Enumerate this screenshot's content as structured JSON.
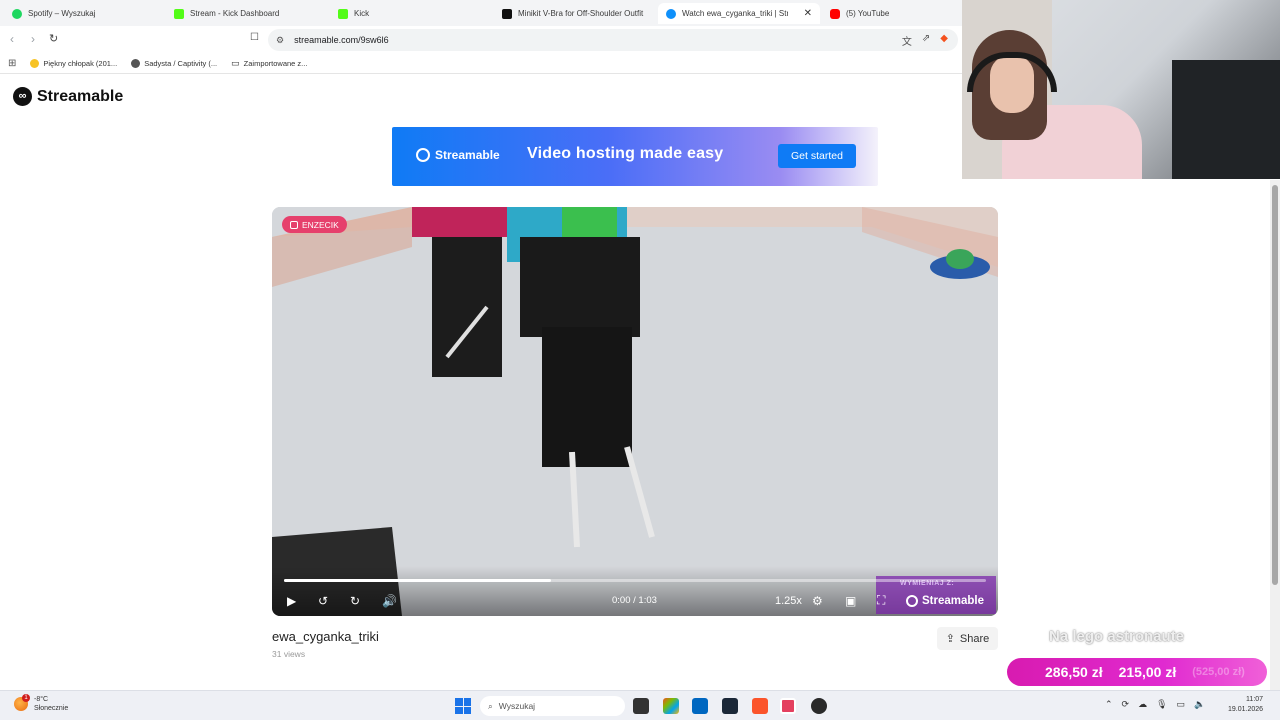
{
  "browser": {
    "tabs": [
      {
        "label": "Spotify – Wyszukaj",
        "favicon": "spotify-icon",
        "active": false
      },
      {
        "label": "Stream - Kick Dashboard",
        "favicon": "kick-icon",
        "active": false
      },
      {
        "label": "Kick",
        "favicon": "kick-icon",
        "active": false
      },
      {
        "label": "Minikit V-Bra for Off-Shoulder Outfit",
        "favicon": "tiktok-icon",
        "active": false
      },
      {
        "label": "Watch ewa_cyganka_triki | Stream",
        "favicon": "streamable-icon",
        "active": true
      },
      {
        "label": "(5) YouTube",
        "favicon": "youtube-icon",
        "active": false
      }
    ],
    "url": "streamable.com/9sw6l6",
    "bookmarks": [
      {
        "label": "Piękny chłopak (201...",
        "icon": "emoji-icon"
      },
      {
        "label": "Sadysta / Captivity (...",
        "icon": "globe-icon"
      },
      {
        "label": "Zaimportowane z...",
        "icon": "folder-icon"
      }
    ]
  },
  "page": {
    "logo_text": "Streamable",
    "banner": {
      "brand": "Streamable",
      "headline": "Video hosting made easy",
      "cta": "Get started"
    },
    "video": {
      "tag": "ENZECIK",
      "time": "0:00 / 1:03",
      "speed": "1.25x",
      "brand": "Streamable",
      "overlay_label": "WYMIENIAJ Z:",
      "progress": 0.38
    },
    "title": "ewa_cyganka_triki",
    "views": "31 views",
    "share_label": "Share"
  },
  "stream_overlay": {
    "caption": "Na lego astronaute",
    "donation_current": "286,50 zł",
    "donation_second": "215,00 zł",
    "donation_goal": "(525,00 zł)"
  },
  "taskbar": {
    "weather_temp": "-8°C",
    "weather_desc": "Słonecznie",
    "weather_badge": "1",
    "search_placeholder": "Wyszukaj",
    "time": "11:07",
    "date": "19.01.2026"
  },
  "colors": {
    "accent": "#0f7bf5",
    "tag": "#e6406c",
    "donation": "#d81bb0"
  }
}
